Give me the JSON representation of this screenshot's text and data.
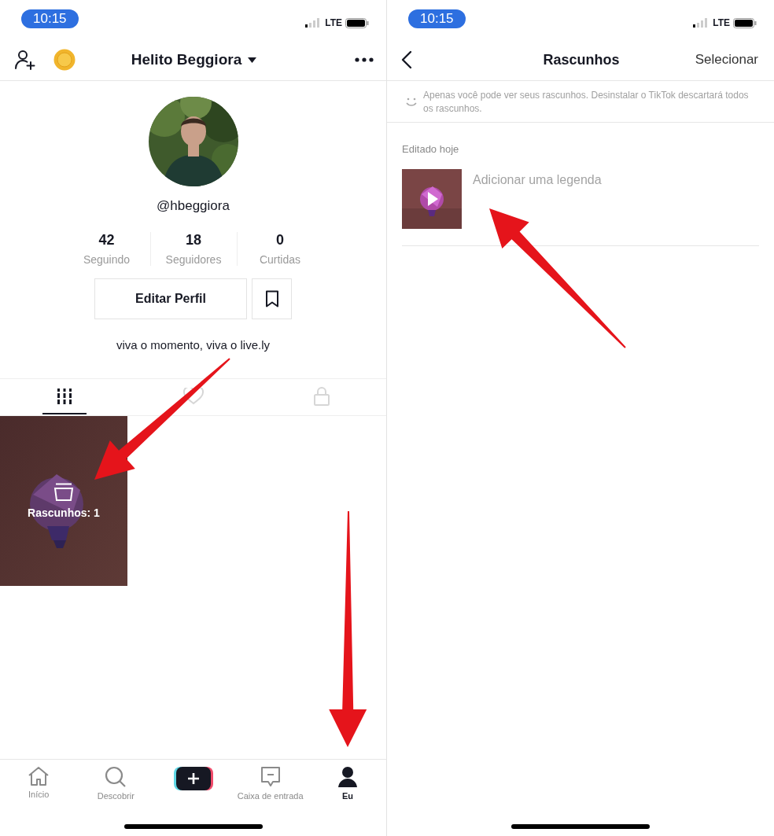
{
  "profile_screen": {
    "status_bar": {
      "time": "10:15",
      "network": "LTE"
    },
    "header": {
      "title": "Helito Beggiora"
    },
    "username": "@hbeggiora",
    "stats": [
      {
        "value": "42",
        "label": "Seguindo"
      },
      {
        "value": "18",
        "label": "Seguidores"
      },
      {
        "value": "0",
        "label": "Curtidas"
      }
    ],
    "edit_button": "Editar Perfil",
    "bio": "viva o momento, viva o live.ly",
    "tabs": [
      {
        "kind": "videos",
        "selected": true
      },
      {
        "kind": "liked",
        "selected": false
      },
      {
        "kind": "private",
        "selected": false
      }
    ],
    "drafts_tile": {
      "label": "Rascunhos: 1"
    },
    "nav": [
      {
        "kind": "home",
        "label": "Início",
        "selected": false
      },
      {
        "kind": "discover",
        "label": "Descobrir",
        "selected": false
      },
      {
        "kind": "create"
      },
      {
        "kind": "inbox",
        "label": "Caixa de entrada",
        "selected": false
      },
      {
        "kind": "me",
        "label": "Eu",
        "selected": true
      }
    ]
  },
  "drafts_screen": {
    "status_bar": {
      "time": "10:15",
      "network": "LTE"
    },
    "header": {
      "title": "Rascunhos",
      "action": "Selecionar"
    },
    "notice": "Apenas você pode ver seus rascunhos. Desinstalar o TikTok descartará todos os rascunhos.",
    "section_title": "Editado hoje",
    "drafts": [
      {
        "caption_placeholder": "Adicionar uma legenda"
      }
    ]
  }
}
